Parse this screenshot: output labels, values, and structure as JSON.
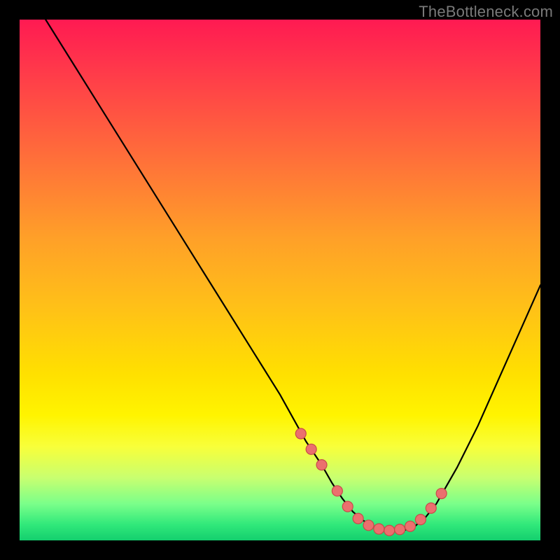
{
  "watermark": "TheBottleneck.com",
  "colors": {
    "page_bg": "#000000",
    "curve": "#000000",
    "dot_fill": "#eb6f6e",
    "dot_stroke": "#c84a4a"
  },
  "chart_data": {
    "type": "line",
    "title": "",
    "xlabel": "",
    "ylabel": "",
    "xlim": [
      0,
      100
    ],
    "ylim": [
      0,
      100
    ],
    "grid": false,
    "legend": false,
    "series": [
      {
        "name": "bottleneck-curve",
        "x": [
          5,
          10,
          15,
          20,
          25,
          30,
          35,
          40,
          45,
          50,
          55,
          58,
          60,
          62,
          64,
          66,
          68,
          70,
          72,
          74,
          76,
          78,
          80,
          84,
          88,
          92,
          96,
          100
        ],
        "y": [
          100,
          92,
          84,
          76,
          68,
          60,
          52,
          44,
          36,
          28,
          19,
          14.5,
          11,
          8,
          5.5,
          3.8,
          2.6,
          2.0,
          1.8,
          2.0,
          2.8,
          4.5,
          7,
          14,
          22,
          31,
          40,
          49
        ]
      }
    ],
    "markers": {
      "name": "highlight-dots",
      "x": [
        54,
        56,
        58,
        61,
        63,
        65,
        67,
        69,
        71,
        73,
        75,
        77,
        79,
        81
      ],
      "y": [
        20.5,
        17.5,
        14.5,
        9.5,
        6.5,
        4.2,
        2.9,
        2.2,
        1.9,
        2.1,
        2.7,
        4.0,
        6.2,
        9.0
      ]
    }
  }
}
